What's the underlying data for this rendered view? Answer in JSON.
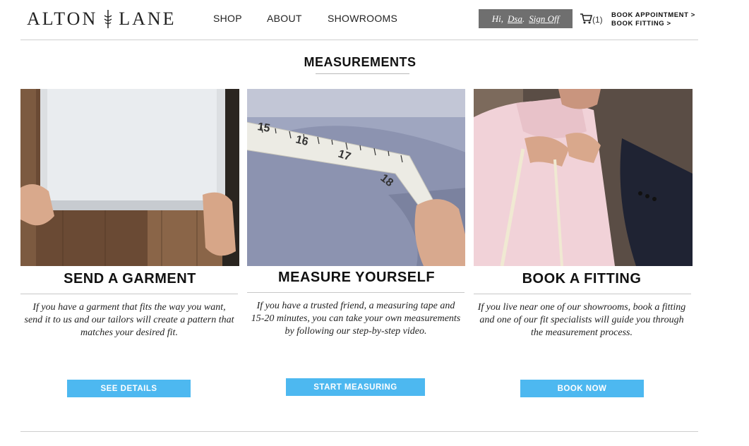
{
  "header": {
    "logo_left": "ALTON",
    "logo_right": "LANE",
    "nav": [
      "SHOP",
      "ABOUT",
      "SHOWROOMS"
    ],
    "user": {
      "greeting": "Hi,",
      "name": "Dsa",
      "separator": ".",
      "sign_off": "Sign Off"
    },
    "cart_count": "(1)",
    "book_appointment": "BOOK APPOINTMENT >",
    "book_fitting": "BOOK FITTING >"
  },
  "page": {
    "title": "MEASUREMENTS"
  },
  "cards": [
    {
      "heading": "SEND A GARMENT",
      "description": "If you have a garment that fits the way you want, send it to us and our tailors will create a pattern that matches your desired fit.",
      "button": "SEE DETAILS"
    },
    {
      "heading": "MEASURE YOURSELF",
      "description": "If you have a trusted friend, a measuring tape and 15-20 minutes, you can take your own measurements by following our step-by-step video.",
      "button": "START MEASURING",
      "tape_numbers": [
        "15",
        "16",
        "17",
        "18"
      ]
    },
    {
      "heading": "BOOK A FITTING",
      "description": "If you live near one of our showrooms, book a fitting and one of our fit specialists will guide you through the measurement process.",
      "button": "BOOK NOW"
    }
  ],
  "colors": {
    "accent": "#4db8f0",
    "user_box": "#6f6f6f"
  },
  "icons": [
    "cart-icon",
    "logo-divider-icon"
  ]
}
